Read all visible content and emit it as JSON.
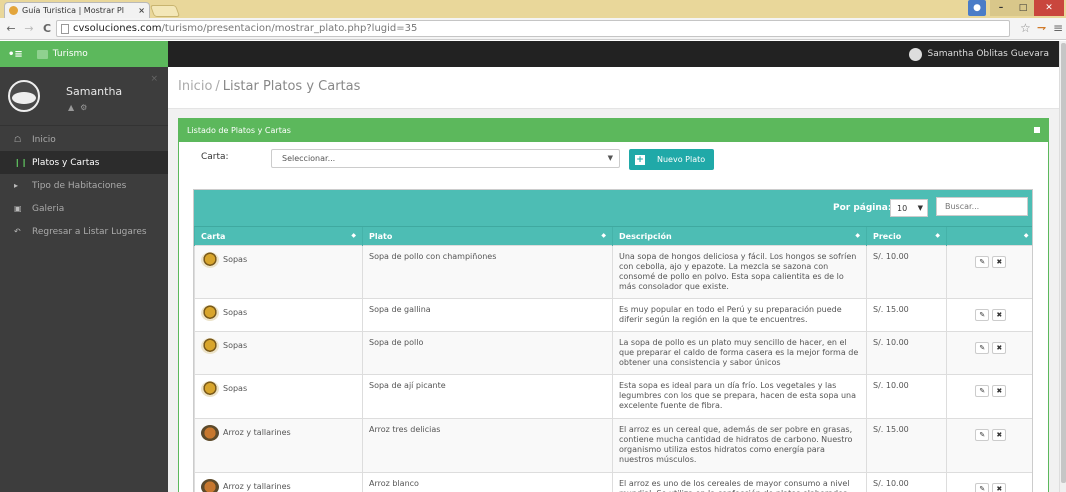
{
  "browser": {
    "tab_title": "Guía Turistica | Mostrar Pl",
    "tab_close": "×",
    "url_host": "cvsoluciones.com",
    "url_path": "/turismo/presentacion/mostrar_plato.php?lugid=35"
  },
  "topbar": {
    "brand": "Turismo",
    "user": "Samantha Oblitas Guevara"
  },
  "sidebar": {
    "profile_name": "Samantha",
    "items": [
      {
        "label": "Inicio",
        "icon": "home-icon"
      },
      {
        "label": "Platos y Cartas",
        "icon": "utensils-icon"
      },
      {
        "label": "Tipo de Habitaciones",
        "icon": "chevron-right-icon"
      },
      {
        "label": "Galeria",
        "icon": "image-icon"
      },
      {
        "label": "Regresar a Listar Lugares",
        "icon": "reply-icon"
      }
    ]
  },
  "breadcrumb": {
    "home": "Inicio",
    "separator": "/",
    "current": "Listar Platos y Cartas"
  },
  "panel": {
    "title": "Listado de Platos y Cartas",
    "carta_label": "Carta:",
    "carta_select": "Seleccionar...",
    "new_button": "Nuevo Plato"
  },
  "table": {
    "per_page_label": "Por página:",
    "per_page_value": "10",
    "search_placeholder": "Buscar...",
    "headers": [
      "Carta",
      "Plato",
      "Descripción",
      "Precio",
      ""
    ],
    "rows": [
      {
        "carta": "Sopas",
        "plato": "Sopa de pollo con champiñones",
        "descripcion": "Una sopa de hongos deliciosa y fácil. Los hongos se sofríen con cebolla, ajo y epazote. La mezcla se sazona con consomé de pollo en polvo. Esta sopa calientita es de lo más consolador que existe.",
        "precio": "S/. 10.00",
        "dish": "soup"
      },
      {
        "carta": "Sopas",
        "plato": "Sopa de gallina",
        "descripcion": "Es muy popular en todo el Perú y su preparación puede diferir según la región en la que te encuentres.",
        "precio": "S/. 15.00",
        "dish": "soup"
      },
      {
        "carta": "Sopas",
        "plato": "Sopa de pollo",
        "descripcion": "La sopa de pollo es un plato muy sencillo de hacer, en el que preparar el caldo de forma casera es la mejor forma de obtener una consistencia y sabor únicos",
        "precio": "S/. 10.00",
        "dish": "soup"
      },
      {
        "carta": "Sopas",
        "plato": "Sopa de ají picante",
        "descripcion": "Esta sopa es ideal para un día frío. Los vegetales y las legumbres con los que se prepara, hacen de esta sopa una excelente fuente de fibra.",
        "precio": "S/. 10.00",
        "dish": "soup"
      },
      {
        "carta": "Arroz y tallarines",
        "plato": "Arroz tres delicias",
        "descripcion": "El arroz es un cereal que, además de ser pobre en grasas, contiene mucha cantidad de hidratos de carbono. Nuestro organismo utiliza estos hidratos como energía para nuestros músculos.",
        "precio": "S/. 15.00",
        "dish": "rice"
      },
      {
        "carta": "Arroz y tallarines",
        "plato": "Arroz blanco",
        "descripcion": "El arroz es uno de los cereales de mayor consumo a nivel mundial. Se utiliza en la confección de platos elaborados",
        "precio": "S/. 10.00",
        "dish": "rice"
      }
    ]
  },
  "colors": {
    "accent_green": "#5cb85c",
    "table_teal": "#4dbdb4",
    "button_teal": "#20a9a8",
    "sidebar_bg": "#3d3d3d",
    "topbar_bg": "#222222"
  }
}
